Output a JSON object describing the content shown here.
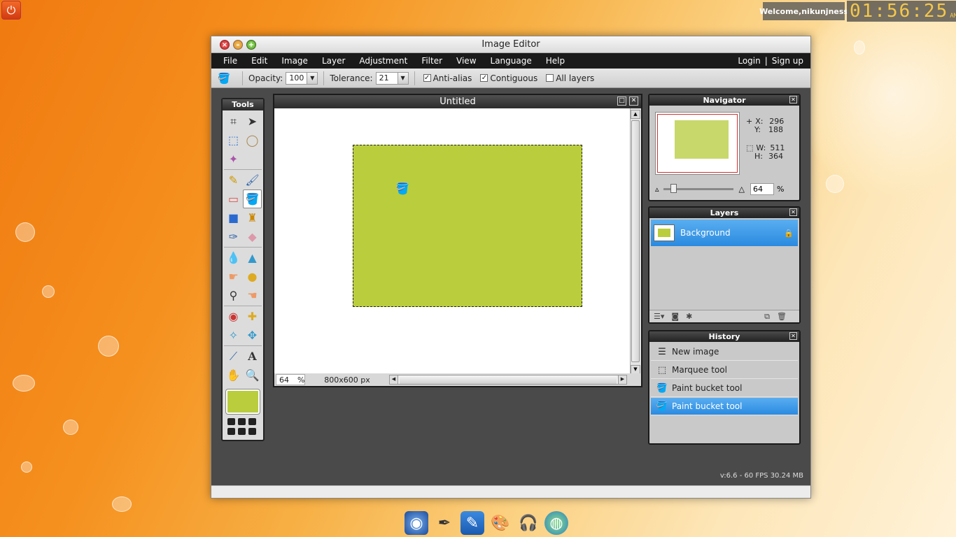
{
  "desktop": {
    "welcome": "Welcome,nikunjness",
    "clock": "01:56:25",
    "clock_ampm": "AM"
  },
  "window": {
    "title": "Image Editor",
    "status_text": "v:6.6 - 60 FPS 30.24 MB"
  },
  "menu": {
    "items": [
      "File",
      "Edit",
      "Image",
      "Layer",
      "Adjustment",
      "Filter",
      "View",
      "Language",
      "Help"
    ],
    "login": "Login",
    "separator": "|",
    "signup": "Sign up"
  },
  "options": {
    "opacity_label": "Opacity:",
    "opacity_value": "100",
    "tolerance_label": "Tolerance:",
    "tolerance_value": "21",
    "antialias_label": "Anti-alias",
    "antialias_checked": true,
    "contiguous_label": "Contiguous",
    "contiguous_checked": true,
    "alllayers_label": "All layers",
    "alllayers_checked": false
  },
  "tools": {
    "title": "Tools",
    "foreground_color": "#bacd3c"
  },
  "document": {
    "title": "Untitled",
    "zoom": "64",
    "zoom_unit": "%",
    "size": "800x600 px"
  },
  "navigator": {
    "title": "Navigator",
    "x_label": "X:",
    "x": "296",
    "y_label": "Y:",
    "y": "188",
    "w_label": "W:",
    "w": "511",
    "h_label": "H:",
    "h": "364",
    "zoom": "64",
    "zoom_unit": "%"
  },
  "layers": {
    "title": "Layers",
    "items": [
      {
        "name": "Background"
      }
    ]
  },
  "history": {
    "title": "History",
    "items": [
      {
        "label": "New image",
        "icon": "new-image-icon"
      },
      {
        "label": "Marquee tool",
        "icon": "marquee-icon"
      },
      {
        "label": "Paint bucket tool",
        "icon": "paint-bucket-icon"
      },
      {
        "label": "Paint bucket tool",
        "icon": "paint-bucket-icon"
      }
    ],
    "selected_index": 3
  },
  "colors": {
    "image_fill": "#bacd3c",
    "selection_blue": "#2a8ae0"
  }
}
